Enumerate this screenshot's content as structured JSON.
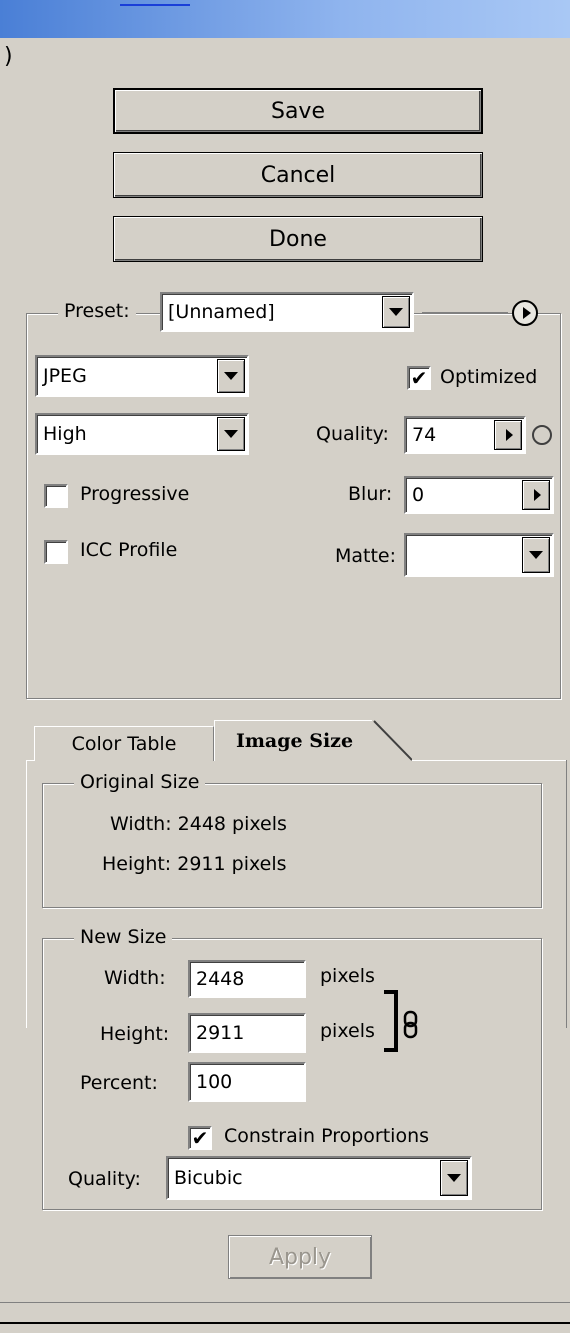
{
  "buttons": {
    "save": "Save",
    "cancel": "Cancel",
    "done": "Done",
    "apply": "Apply"
  },
  "settings": {
    "preset_label": "Preset:",
    "preset_value": "[Unnamed]",
    "format": "JPEG",
    "quality_preset": "High",
    "optimized_label": "Optimized",
    "optimized_checked": true,
    "quality_label": "Quality:",
    "quality_value": "74",
    "blur_label": "Blur:",
    "blur_value": "0",
    "matte_label": "Matte:",
    "matte_value": "",
    "progressive_label": "Progressive",
    "progressive_checked": false,
    "icc_label": "ICC Profile",
    "icc_checked": false
  },
  "tabs": [
    "Color Table",
    "Image Size"
  ],
  "active_tab": "Image Size",
  "original_size": {
    "legend": "Original Size",
    "width_text": "Width: 2448 pixels",
    "height_text": "Height: 2911 pixels"
  },
  "new_size": {
    "legend": "New Size",
    "width_label": "Width:",
    "width_value": "2448",
    "height_label": "Height:",
    "height_value": "2911",
    "unit": "pixels",
    "percent_label": "Percent:",
    "percent_value": "100",
    "constrain_label": "Constrain Proportions",
    "constrain_checked": true,
    "quality_label": "Quality:",
    "quality_value": "Bicubic"
  },
  "check_glyph": "✔",
  "icons": [
    "flyout-menu-icon",
    "droplet-icon",
    "link-chain-icon"
  ]
}
